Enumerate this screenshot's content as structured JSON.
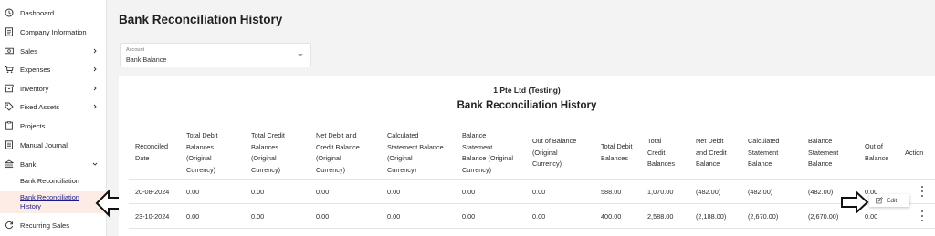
{
  "sidebar": {
    "items": [
      {
        "label": "Dashboard",
        "icon": "clock-icon"
      },
      {
        "label": "Company Information",
        "icon": "document-icon"
      },
      {
        "label": "Sales",
        "icon": "money-icon"
      },
      {
        "label": "Expenses",
        "icon": "cart-icon"
      },
      {
        "label": "Inventory",
        "icon": "box-icon"
      },
      {
        "label": "Fixed Assets",
        "icon": "tag-icon"
      },
      {
        "label": "Projects",
        "icon": "clipboard-icon"
      },
      {
        "label": "Manual Journal",
        "icon": "journal-icon"
      },
      {
        "label": "Bank",
        "icon": "bank-icon"
      }
    ],
    "bank_sub": {
      "reconciliation": "Bank Reconciliation",
      "history_line1": "Bank Reconciliation",
      "history_line2": "History"
    },
    "recurring_sales": "Recurring Sales"
  },
  "page": {
    "title": "Bank Reconciliation History"
  },
  "account": {
    "label": "Account",
    "value": "Bank Balance"
  },
  "report": {
    "company": "1 Pte Ltd (Testing)",
    "title": "Bank Reconciliation History"
  },
  "table": {
    "headers": [
      [
        "Reconciled",
        "Date"
      ],
      [
        "Total Debit",
        "Balances",
        "(Original",
        "Currency)"
      ],
      [
        "Total Credit",
        "Balances",
        "(Original",
        "Currency)"
      ],
      [
        "Net Debit and",
        "Credit Balance",
        "(Original",
        "Currency)"
      ],
      [
        "Calculated",
        "Statement Balance",
        "(Original",
        "Currency)"
      ],
      [
        "Balance",
        "Statement",
        "Balance (Original",
        "Currency)"
      ],
      [
        "Out of Balance",
        "(Original",
        "Currency)"
      ],
      [
        "Total Debit",
        "Balances"
      ],
      [
        "Total",
        "Credit",
        "Balances"
      ],
      [
        "Net Debit",
        "and Credit",
        "Balance"
      ],
      [
        "Calculated",
        "Statement",
        "Balance"
      ],
      [
        "Balance",
        "Statement",
        "Balance"
      ],
      [
        "Out of",
        "Balance"
      ],
      [
        "Action"
      ]
    ],
    "rows": [
      [
        "20-08-2024",
        "0.00",
        "0.00",
        "0.00",
        "0.00",
        "0.00",
        "0.00",
        "588.00",
        "1,070.00",
        "(482.00)",
        "(482.00)",
        "(482.00)",
        "0.00"
      ],
      [
        "23-10-2024",
        "0.00",
        "0.00",
        "0.00",
        "0.00",
        "0.00",
        "0.00",
        "400.00",
        "2,588.00",
        "(2,188.00)",
        "(2,670.00)",
        "(2,670.00)",
        "0.00"
      ]
    ]
  },
  "menu": {
    "edit_label": "Edit"
  }
}
